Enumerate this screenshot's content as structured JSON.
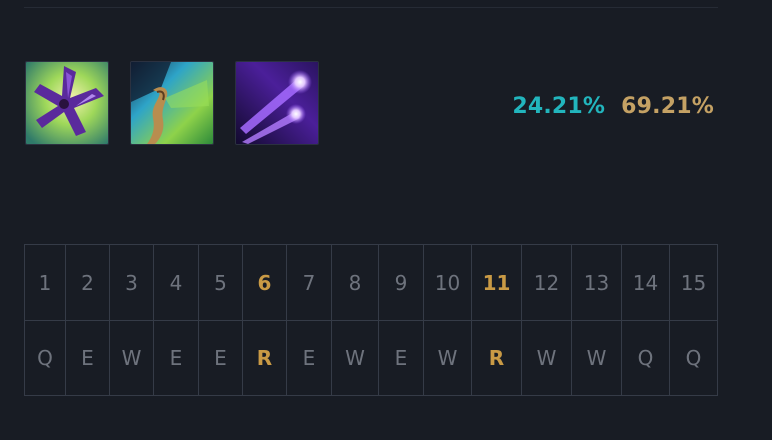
{
  "skills": {
    "icons": [
      "spell-q-icon",
      "spell-e-icon",
      "spell-w-icon"
    ]
  },
  "stats": {
    "pick_rate": "24.21%",
    "win_rate": "69.21%",
    "pick_rate_color": "#22b5bd",
    "win_rate_color": "#c4a164"
  },
  "skill_order": {
    "levels": [
      "1",
      "2",
      "3",
      "4",
      "5",
      "6",
      "7",
      "8",
      "9",
      "10",
      "11",
      "12",
      "13",
      "14",
      "15"
    ],
    "keys": [
      "Q",
      "E",
      "W",
      "E",
      "E",
      "R",
      "E",
      "W",
      "E",
      "W",
      "R",
      "W",
      "W",
      "Q",
      "Q"
    ],
    "highlight_color": "#c99a45",
    "highlighted_levels": [
      "6",
      "11"
    ]
  }
}
